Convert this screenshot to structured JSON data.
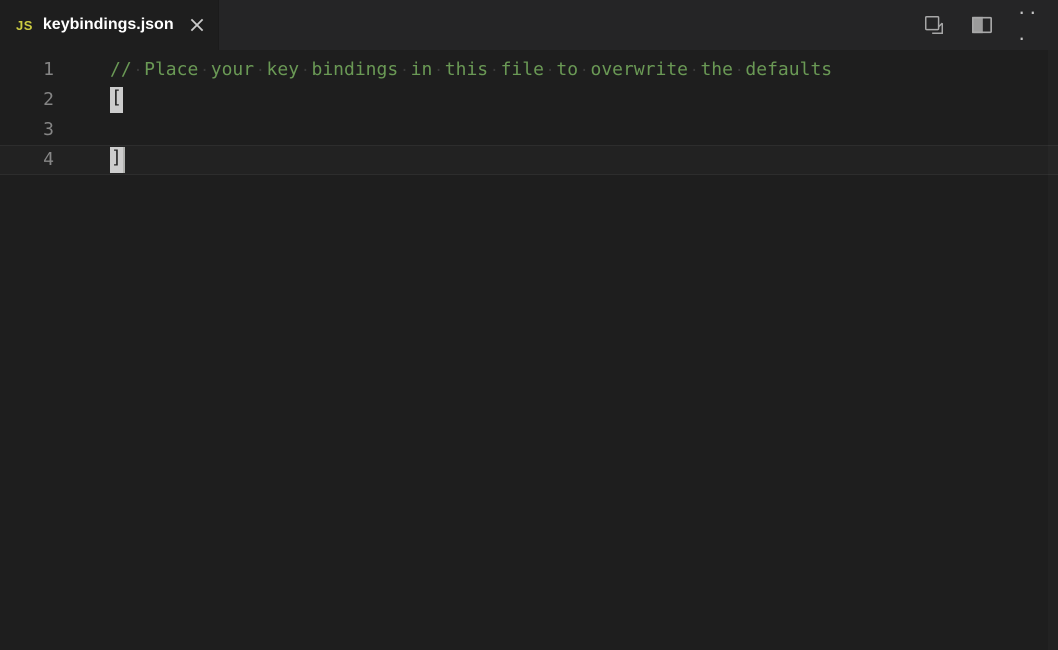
{
  "tab": {
    "iconLabel": "JS",
    "title": "keybindings.json"
  },
  "editor": {
    "lineNumbers": [
      "1",
      "2",
      "3",
      "4"
    ],
    "lines": {
      "comment": "// Place your key bindings in this file to overwrite the defaults",
      "openBracket": "[",
      "closeBracket": "]"
    }
  }
}
